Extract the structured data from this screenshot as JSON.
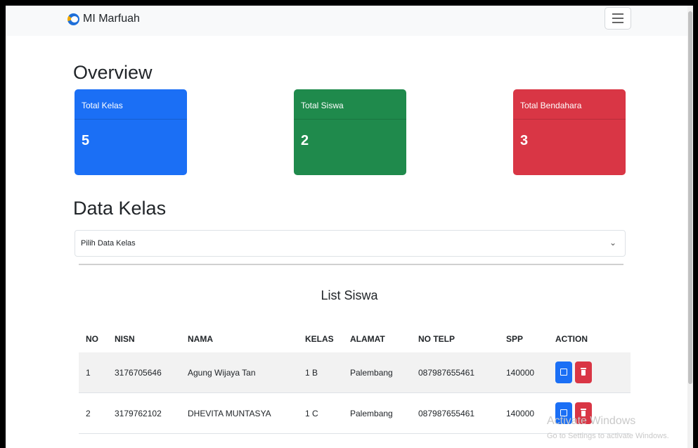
{
  "navbar": {
    "brand_text": "MI Marfuah",
    "logo_icon": "school-logo-icon",
    "toggler_icon": "hamburger-menu-icon"
  },
  "overview": {
    "heading": "Overview",
    "cards": [
      {
        "label": "Total Kelas",
        "value": "5",
        "color": "#1b6ff5"
      },
      {
        "label": "Total Siswa",
        "value": "2",
        "color": "#1f8a4c"
      },
      {
        "label": "Total Bendahara",
        "value": "3",
        "color": "#d93645"
      }
    ]
  },
  "data_kelas": {
    "heading": "Data Kelas",
    "select_value": "Pilih Data Kelas"
  },
  "list_siswa": {
    "title": "List Siswa",
    "columns": [
      "NO",
      "NISN",
      "NAMA",
      "KELAS",
      "ALAMAT",
      "NO TELP",
      "SPP",
      "ACTION"
    ],
    "rows": [
      {
        "no": "1",
        "nisn": "3176705646",
        "nama": "Agung Wijaya Tan",
        "kelas": "1 B",
        "alamat": "Palembang",
        "no_telp": "087987655461",
        "spp": "140000"
      },
      {
        "no": "2",
        "nisn": "3179762102",
        "nama": "DHEVITA MUNTASYA",
        "kelas": "1 C",
        "alamat": "Palembang",
        "no_telp": "087987655461",
        "spp": "140000"
      }
    ],
    "action_icons": [
      "edit-icon",
      "trash-icon"
    ]
  },
  "watermark": {
    "line1": "Activate Windows",
    "line2": "Go to Settings to activate Windows."
  }
}
